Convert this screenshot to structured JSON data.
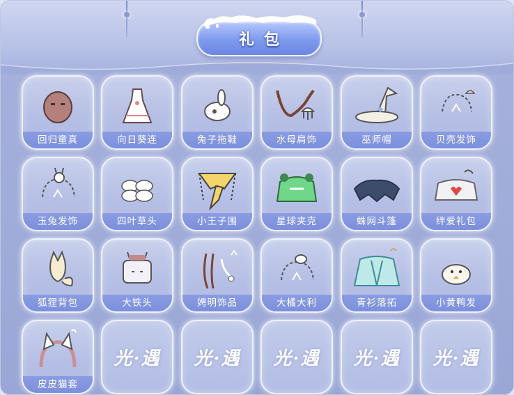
{
  "title": "礼包",
  "locked_logo": "光·遇",
  "items": [
    {
      "label": "回归童真",
      "icon": "bald-head-mask-icon"
    },
    {
      "label": "向日葵连",
      "icon": "sunflower-dress-icon"
    },
    {
      "label": "兔子拖鞋",
      "icon": "bunny-slipper-icon"
    },
    {
      "label": "水母肩饰",
      "icon": "jellyfish-shoulder-icon"
    },
    {
      "label": "巫师帽",
      "icon": "wizard-hat-icon"
    },
    {
      "label": "贝壳发饰",
      "icon": "shell-hairpin-icon"
    },
    {
      "label": "玉兔发饰",
      "icon": "jade-rabbit-hairpin-icon"
    },
    {
      "label": "四叶草头",
      "icon": "four-leaf-clover-icon"
    },
    {
      "label": "小王子围",
      "icon": "little-prince-scarf-icon"
    },
    {
      "label": "星球夹克",
      "icon": "planet-jacket-icon"
    },
    {
      "label": "蛛网斗篷",
      "icon": "spiderweb-cape-icon"
    },
    {
      "label": "绊爱礼包",
      "icon": "kizuna-cape-icon"
    },
    {
      "label": "狐狸背包",
      "icon": "fox-backpack-icon"
    },
    {
      "label": "大铁头",
      "icon": "tv-head-icon"
    },
    {
      "label": "娉明饰品",
      "icon": "hanging-accessory-icon"
    },
    {
      "label": "大橘大利",
      "icon": "orange-hairpin-icon"
    },
    {
      "label": "青衫落拓",
      "icon": "cyan-robe-cape-icon"
    },
    {
      "label": "小黄鸭发",
      "icon": "duck-hat-icon"
    },
    {
      "label": "皮皮猫套",
      "icon": "cat-ear-headband-icon"
    }
  ],
  "locked_count": 5,
  "colors": {
    "panel": "#a5b0db",
    "label_bar": "#8a9ce2",
    "title_pill": "#7f9bef"
  }
}
